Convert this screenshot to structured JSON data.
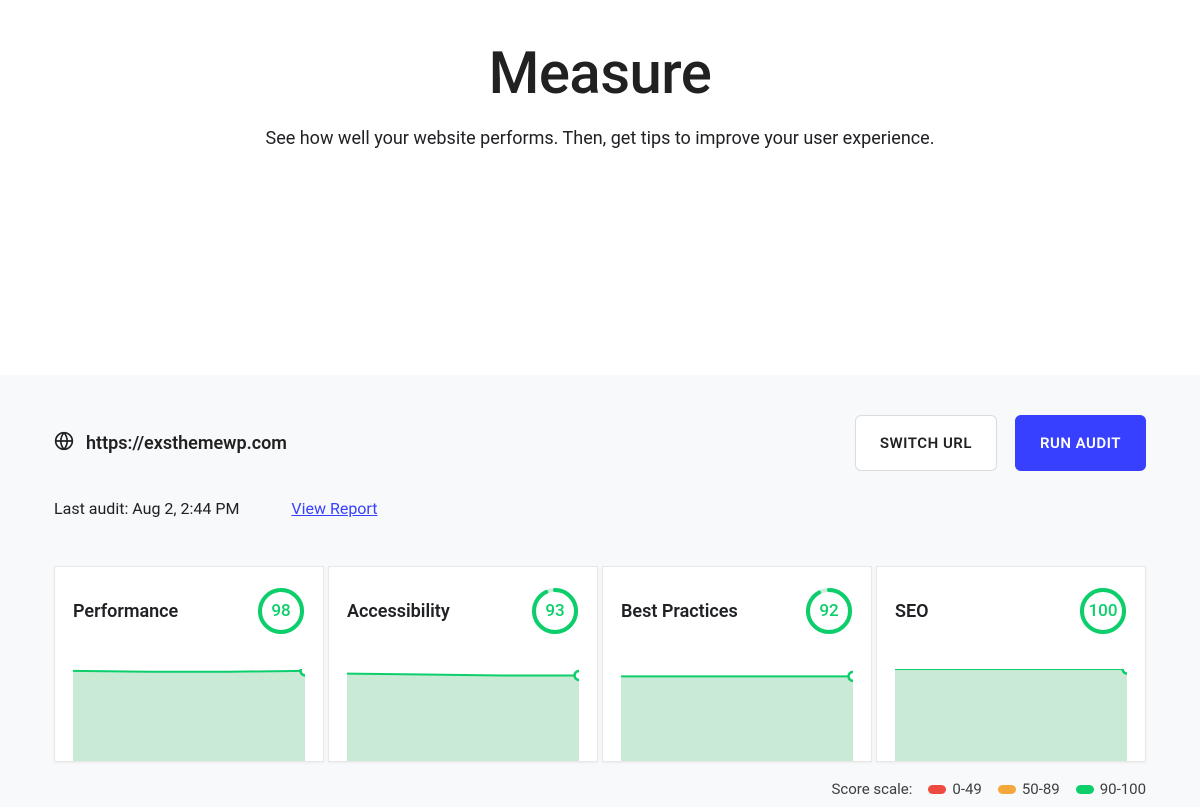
{
  "hero": {
    "title": "Measure",
    "subtitle": "See how well your website performs. Then, get tips to improve your user experience."
  },
  "url": "https://exsthemewp.com",
  "buttons": {
    "switch": "SWITCH URL",
    "run": "RUN AUDIT"
  },
  "meta": {
    "last_audit": "Last audit: Aug 2, 2:44 PM",
    "view_report": "View Report"
  },
  "cards": [
    {
      "title": "Performance",
      "score": 98
    },
    {
      "title": "Accessibility",
      "score": 93
    },
    {
      "title": "Best Practices",
      "score": 92
    },
    {
      "title": "SEO",
      "score": 100
    }
  ],
  "scale": {
    "label": "Score scale:",
    "ranges": [
      "0-49",
      "50-89",
      "90-100"
    ]
  },
  "colors": {
    "accent": "#3740ff",
    "good": "#0cce6b",
    "warn": "#f4a73a",
    "bad": "#ef4a3f"
  },
  "chart_data": [
    {
      "type": "area",
      "title": "Performance",
      "y": [
        98,
        97,
        97,
        98
      ],
      "ylim": [
        0,
        100
      ]
    },
    {
      "type": "area",
      "title": "Accessibility",
      "y": [
        95,
        94,
        93,
        93
      ],
      "ylim": [
        0,
        100
      ]
    },
    {
      "type": "area",
      "title": "Best Practices",
      "y": [
        92,
        92,
        92,
        92
      ],
      "ylim": [
        0,
        100
      ]
    },
    {
      "type": "area",
      "title": "SEO",
      "y": [
        100,
        100,
        100,
        100
      ],
      "ylim": [
        0,
        100
      ]
    }
  ]
}
